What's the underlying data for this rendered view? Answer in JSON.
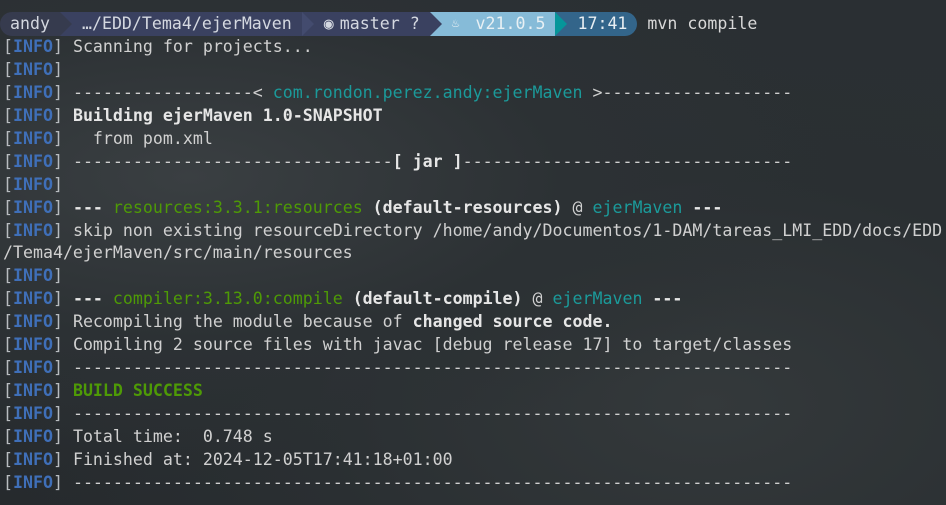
{
  "prompt": {
    "user": "andy",
    "path": "…/EDD/Tema4/ejerMaven",
    "git_icon": "github-icon",
    "branch": "master ?",
    "java_icon": "java-icon",
    "java_version": "v21.0.5",
    "time": "17:41",
    "command": "mvn compile"
  },
  "colors": {
    "info": "#3f6fb8",
    "green": "#4e9a06",
    "teal": "#1b9a9a"
  },
  "lines": [
    [
      {
        "c": "b",
        "t": "["
      },
      {
        "c": "i",
        "t": "INFO"
      },
      {
        "c": "b",
        "t": "] "
      },
      {
        "c": "",
        "t": "Scanning for projects..."
      }
    ],
    [
      {
        "c": "b",
        "t": "["
      },
      {
        "c": "i",
        "t": "INFO"
      },
      {
        "c": "b",
        "t": "]"
      }
    ],
    [
      {
        "c": "b",
        "t": "["
      },
      {
        "c": "i",
        "t": "INFO"
      },
      {
        "c": "b",
        "t": "] "
      },
      {
        "c": "",
        "t": "------------------< "
      },
      {
        "c": "t",
        "t": "com.rondon.perez.andy:ejerMaven"
      },
      {
        "c": "",
        "t": " >-------------------"
      }
    ],
    [
      {
        "c": "b",
        "t": "["
      },
      {
        "c": "i",
        "t": "INFO"
      },
      {
        "c": "b",
        "t": "] "
      },
      {
        "c": "bold",
        "t": "Building ejerMaven 1.0-SNAPSHOT"
      }
    ],
    [
      {
        "c": "b",
        "t": "["
      },
      {
        "c": "i",
        "t": "INFO"
      },
      {
        "c": "b",
        "t": "] "
      },
      {
        "c": "",
        "t": "  from pom.xml"
      }
    ],
    [
      {
        "c": "b",
        "t": "["
      },
      {
        "c": "i",
        "t": "INFO"
      },
      {
        "c": "b",
        "t": "] "
      },
      {
        "c": "",
        "t": "--------------------------------"
      },
      {
        "c": "bold",
        "t": "[ jar ]"
      },
      {
        "c": "",
        "t": "---------------------------------"
      }
    ],
    [
      {
        "c": "b",
        "t": "["
      },
      {
        "c": "i",
        "t": "INFO"
      },
      {
        "c": "b",
        "t": "]"
      }
    ],
    [
      {
        "c": "b",
        "t": "["
      },
      {
        "c": "i",
        "t": "INFO"
      },
      {
        "c": "b",
        "t": "] "
      },
      {
        "c": "bold",
        "t": "--- "
      },
      {
        "c": "g",
        "t": "resources:3.3.1:resources"
      },
      {
        "c": "bold",
        "t": " (default-resources)"
      },
      {
        "c": "",
        "t": " @ "
      },
      {
        "c": "t",
        "t": "ejerMaven"
      },
      {
        "c": "bold",
        "t": " ---"
      }
    ],
    [
      {
        "c": "b",
        "t": "["
      },
      {
        "c": "i",
        "t": "INFO"
      },
      {
        "c": "b",
        "t": "] "
      },
      {
        "c": "",
        "t": "skip non existing resourceDirectory /home/andy/Documentos/1-DAM/tareas_LMI_EDD/docs/EDD"
      }
    ],
    [
      {
        "c": "",
        "t": "/Tema4/ejerMaven/src/main/resources"
      }
    ],
    [
      {
        "c": "b",
        "t": "["
      },
      {
        "c": "i",
        "t": "INFO"
      },
      {
        "c": "b",
        "t": "]"
      }
    ],
    [
      {
        "c": "b",
        "t": "["
      },
      {
        "c": "i",
        "t": "INFO"
      },
      {
        "c": "b",
        "t": "] "
      },
      {
        "c": "bold",
        "t": "--- "
      },
      {
        "c": "g",
        "t": "compiler:3.13.0:compile"
      },
      {
        "c": "bold",
        "t": " (default-compile)"
      },
      {
        "c": "",
        "t": " @ "
      },
      {
        "c": "t",
        "t": "ejerMaven"
      },
      {
        "c": "bold",
        "t": " ---"
      }
    ],
    [
      {
        "c": "b",
        "t": "["
      },
      {
        "c": "i",
        "t": "INFO"
      },
      {
        "c": "b",
        "t": "] "
      },
      {
        "c": "",
        "t": "Recompiling the module because of "
      },
      {
        "c": "bold",
        "t": "changed source code."
      }
    ],
    [
      {
        "c": "b",
        "t": "["
      },
      {
        "c": "i",
        "t": "INFO"
      },
      {
        "c": "b",
        "t": "] "
      },
      {
        "c": "",
        "t": "Compiling 2 source files with javac [debug release 17] to target/classes"
      }
    ],
    [
      {
        "c": "b",
        "t": "["
      },
      {
        "c": "i",
        "t": "INFO"
      },
      {
        "c": "b",
        "t": "] "
      },
      {
        "c": "",
        "t": "------------------------------------------------------------------------"
      }
    ],
    [
      {
        "c": "b",
        "t": "["
      },
      {
        "c": "i",
        "t": "INFO"
      },
      {
        "c": "b",
        "t": "] "
      },
      {
        "c": "gb",
        "t": "BUILD SUCCESS"
      }
    ],
    [
      {
        "c": "b",
        "t": "["
      },
      {
        "c": "i",
        "t": "INFO"
      },
      {
        "c": "b",
        "t": "] "
      },
      {
        "c": "",
        "t": "------------------------------------------------------------------------"
      }
    ],
    [
      {
        "c": "b",
        "t": "["
      },
      {
        "c": "i",
        "t": "INFO"
      },
      {
        "c": "b",
        "t": "] "
      },
      {
        "c": "",
        "t": "Total time:  0.748 s"
      }
    ],
    [
      {
        "c": "b",
        "t": "["
      },
      {
        "c": "i",
        "t": "INFO"
      },
      {
        "c": "b",
        "t": "] "
      },
      {
        "c": "",
        "t": "Finished at: 2024-12-05T17:41:18+01:00"
      }
    ],
    [
      {
        "c": "b",
        "t": "["
      },
      {
        "c": "i",
        "t": "INFO"
      },
      {
        "c": "b",
        "t": "] "
      },
      {
        "c": "",
        "t": "------------------------------------------------------------------------"
      }
    ]
  ]
}
